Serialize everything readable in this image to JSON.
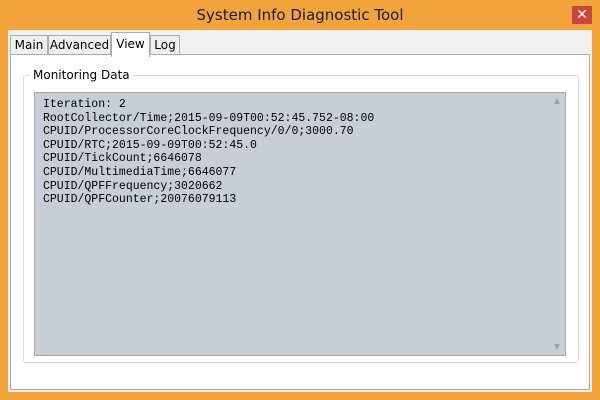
{
  "window": {
    "title": "System Info Diagnostic Tool",
    "close_glyph": "✕",
    "frame_color": "#f2a33a"
  },
  "tabs": [
    {
      "label": "Main"
    },
    {
      "label": "Advanced"
    },
    {
      "label": "View"
    },
    {
      "label": "Log"
    }
  ],
  "active_tab": "View",
  "monitoring": {
    "legend": "Monitoring Data",
    "lines": [
      "Iteration: 2",
      "RootCollector/Time;2015-09-09T00:52:45.752-08:00",
      "CPUID/ProcessorCoreClockFrequency/0/0;3000.70",
      "CPUID/RTC;2015-09-09T00:52:45.0",
      "CPUID/TickCount;6646078",
      "CPUID/MultimediaTime;6646077",
      "CPUID/QPFFrequency;3020662",
      "CPUID/QPFCounter;20076079113"
    ],
    "scroll_up_glyph": "▲",
    "scroll_down_glyph": "▼"
  }
}
